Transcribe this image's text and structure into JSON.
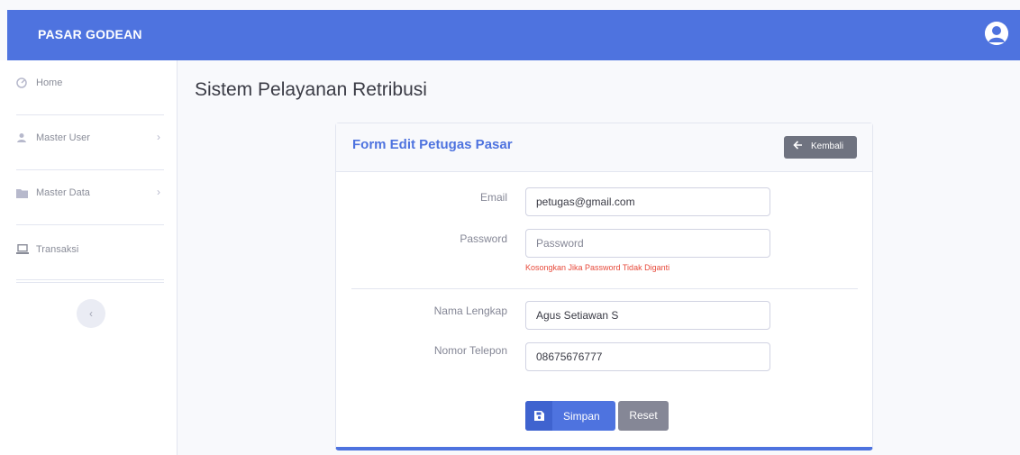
{
  "app": {
    "brand": "PASAR GODEAN"
  },
  "sidebar": {
    "items": [
      {
        "label": "Home",
        "icon": "dashboard-icon"
      },
      {
        "label": "Master User",
        "icon": "user-icon",
        "chevron": "›"
      },
      {
        "label": "Master Data",
        "icon": "folder-icon",
        "chevron": "›"
      },
      {
        "label": "Transaksi",
        "icon": "laptop-icon"
      }
    ],
    "collapse_glyph": "‹"
  },
  "page": {
    "title": "Sistem Pelayanan Retribusi"
  },
  "form": {
    "title": "Form Edit Petugas Pasar",
    "back_label": "Kembali",
    "email_label": "Email",
    "email_value": "petugas@gmail.com",
    "password_label": "Password",
    "password_placeholder": "Password",
    "password_hint": "Kosongkan Jika Password Tidak Diganti",
    "name_label": "Nama Lengkap",
    "name_value": "Agus Setiawan S",
    "phone_label": "Nomor Telepon",
    "phone_value": "08675676777",
    "save_label": "Simpan",
    "reset_label": "Reset"
  },
  "colors": {
    "primary": "#4e73df",
    "secondary": "#858796",
    "danger": "#e74a3b"
  }
}
